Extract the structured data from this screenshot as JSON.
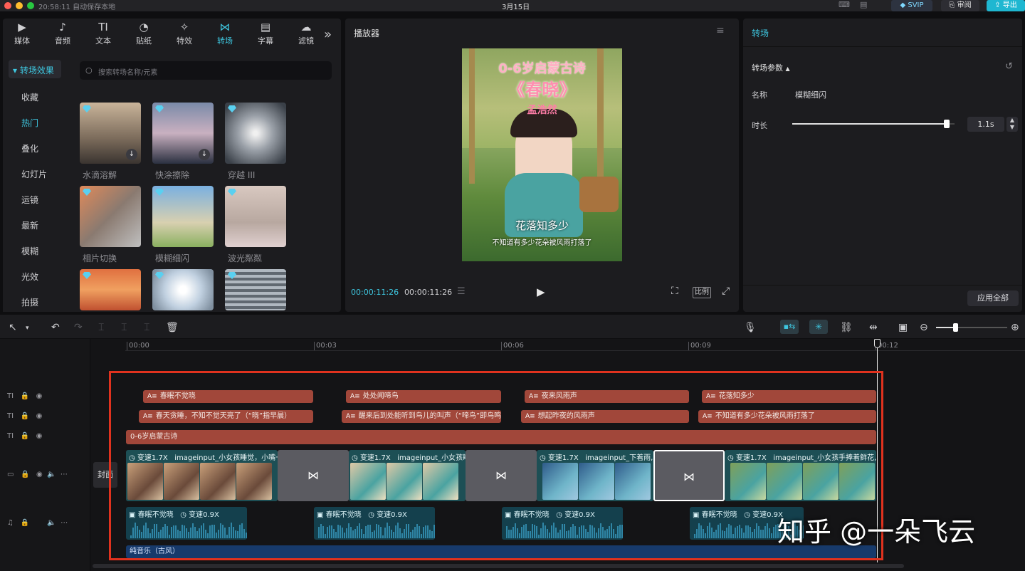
{
  "titlebar": {
    "autosave": "20:58:11 自动保存本地",
    "date": "3月15日",
    "svip": "SVIP",
    "review": "审阅",
    "export": "导出"
  },
  "toptabs": [
    {
      "label": "媒体",
      "icon": "media-icon"
    },
    {
      "label": "音频",
      "icon": "audio-icon"
    },
    {
      "label": "文本",
      "icon": "text-icon"
    },
    {
      "label": "贴纸",
      "icon": "sticker-icon"
    },
    {
      "label": "特效",
      "icon": "effects-icon"
    },
    {
      "label": "转场",
      "icon": "transition-icon"
    },
    {
      "label": "字幕",
      "icon": "subtitle-icon"
    },
    {
      "label": "滤镜",
      "icon": "filter-icon"
    }
  ],
  "sidebar": {
    "header": "转场效果",
    "items": [
      "收藏",
      "热门",
      "叠化",
      "幻灯片",
      "运镜",
      "最新",
      "模糊",
      "光效",
      "拍摄"
    ],
    "active": "热门"
  },
  "search": {
    "placeholder": "搜索转场名称/元素"
  },
  "thumbs": [
    {
      "label": "水滴溶解"
    },
    {
      "label": "快涂擦除"
    },
    {
      "label": "穿越 III"
    },
    {
      "label": "相片切换"
    },
    {
      "label": "模糊细闪"
    },
    {
      "label": "波光粼粼"
    },
    {
      "label": ""
    },
    {
      "label": ""
    },
    {
      "label": ""
    }
  ],
  "player": {
    "title": "播放器",
    "poster_title": "0-6岁启蒙古诗",
    "poster_poem": "《春晓》",
    "poster_author": "孟浩然",
    "caption_main": "花落知多少",
    "caption_sub": "不知道有多少花朵被风雨打落了",
    "time_current": "00:00:11:26",
    "time_total": "00:00:11:26",
    "ratio": "比例"
  },
  "inspector": {
    "title": "转场",
    "section": "转场参数",
    "name_label": "名称",
    "name_value": "模糊细闪",
    "duration_label": "时长",
    "duration_value": "1.1s",
    "duration_fraction": 0.95,
    "apply_all": "应用全部"
  },
  "ruler": [
    "00:00",
    "00:03",
    "00:06",
    "00:09",
    "00:12"
  ],
  "tracks": {
    "cover": "封面",
    "text1": [
      "春眠不觉晓",
      "处处闻啼鸟",
      "夜来风雨声",
      "花落知多少"
    ],
    "text2": [
      "春天贪睡，不知不觉天亮了（“晓”指早晨）",
      "醒来后到处能听到鸟儿的叫声（“啼鸟”即鸟鸣",
      "想起昨夜的风雨声",
      "不知道有多少花朵被风雨打落了"
    ],
    "title_clip": "0-6岁启蒙古诗",
    "video": [
      {
        "speed": "变速1.7X",
        "name": "imageinput_小女孩睡觉，小嘴一"
      },
      {
        "speed": "变速1.7X",
        "name": "imageinput_小女孩睡"
      },
      {
        "speed": "变速1.7X",
        "name": "imageinput_下着雨,"
      },
      {
        "speed": "变速1.7X",
        "name": "imageinput_小女孩手捧着鲜花,"
      }
    ],
    "audio": [
      {
        "name": "春眠不觉晓",
        "speed": "变速0.9X"
      },
      {
        "name": "春眠不觉晓",
        "speed": "变速0.9X"
      },
      {
        "name": "春眠不觉晓",
        "speed": "变速0.9X"
      },
      {
        "name": "春眠不觉晓",
        "speed": "变速0.9X"
      }
    ],
    "music": "纯音乐（古风）"
  },
  "watermark": "知乎 @一朵飞云",
  "colors": {
    "accent": "#3ec7e0",
    "highlight_box": "#e0321e",
    "text_clip": "#a1473a",
    "video_clip": "#1d4f55",
    "music_clip": "#173a6b"
  }
}
